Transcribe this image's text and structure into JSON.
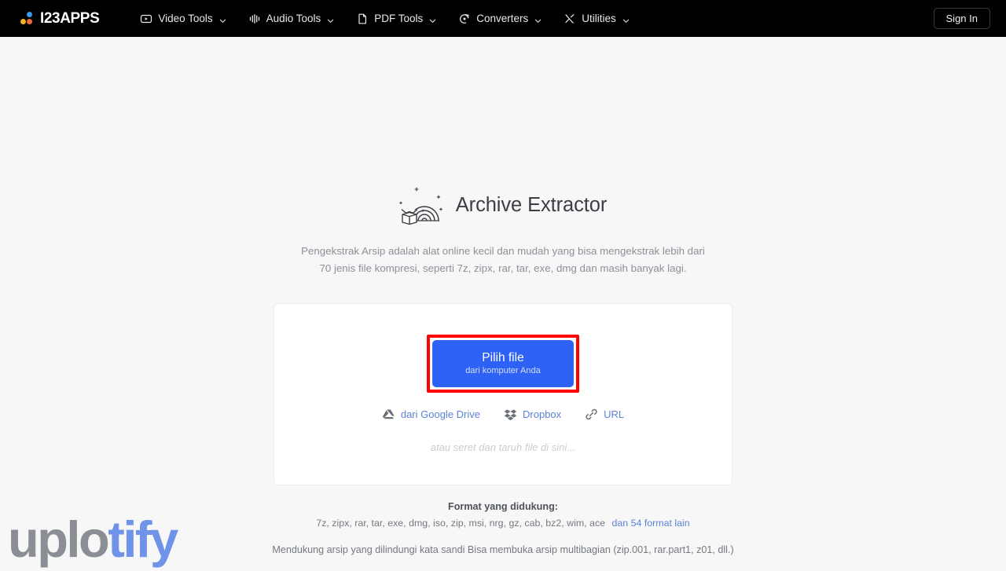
{
  "navbar": {
    "logo": {
      "text": "I23APPS",
      "icon": "three-dots-logo-icon",
      "colors": {
        "blue": "#3b9bf0",
        "yellow": "#f2b529",
        "orange": "#ef6b34"
      }
    },
    "items": [
      {
        "label": "Video Tools",
        "icon": "video-play-icon"
      },
      {
        "label": "Audio Tools",
        "icon": "audio-waveform-icon"
      },
      {
        "label": "PDF Tools",
        "icon": "document-page-icon"
      },
      {
        "label": "Converters",
        "icon": "circular-refresh-icon"
      },
      {
        "label": "Utilities",
        "icon": "crossed-tools-icon"
      }
    ],
    "sign_in_label": "Sign In"
  },
  "hero": {
    "icon": "rainbow-archive-box-icon",
    "title": "Archive Extractor",
    "subtitle": "Pengekstrak Arsip adalah alat online kecil dan mudah yang bisa mengekstrak lebih dari 70 jenis file kompresi, seperti 7z, zipx, rar, tar, exe, dmg dan masih banyak lagi."
  },
  "upload_card": {
    "choose_button": {
      "main_label": "Pilih file",
      "sub_label": "dari komputer Anda",
      "color": "#2e62f6",
      "highlight_color": "#ff0000"
    },
    "cloud_options": [
      {
        "label": "dari Google Drive",
        "icon": "google-drive-icon"
      },
      {
        "label": "Dropbox",
        "icon": "dropbox-icon"
      },
      {
        "label": "URL",
        "icon": "link-chain-icon"
      }
    ],
    "drop_hint": "atau seret dan taruh file di sini..."
  },
  "info": {
    "heading": "Format yang didukung:",
    "format_list": "7z, zipx, rar, tar, exe, dmg, iso, zip, msi, nrg, gz, cab, bz2, wim, ace",
    "more_formats_link": "dan 54 format lain",
    "note": "Mendukung arsip yang dilindungi kata sandi Bisa membuka arsip multibagian (zip.001, rar.part1, z01, dll.)"
  },
  "watermark": {
    "part1": "uplo",
    "part2": "tify",
    "color1": "#8b8e94",
    "color2": "#6e93e8"
  }
}
